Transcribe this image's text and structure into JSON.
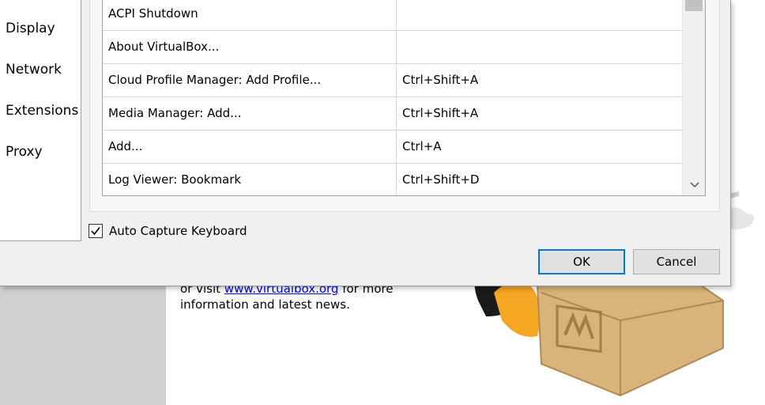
{
  "background": {
    "welcome_prefix": "or visit ",
    "welcome_link": "www.virtualbox.org",
    "welcome_suffix": " for more information and latest news."
  },
  "sidebar": {
    "items": [
      {
        "label": "Display"
      },
      {
        "label": "Network"
      },
      {
        "label": "Extensions"
      },
      {
        "label": "Proxy"
      }
    ]
  },
  "shortcuts_table": {
    "rows": [
      {
        "action": "ACPI Shutdown",
        "shortcut": ""
      },
      {
        "action": "About VirtualBox...",
        "shortcut": ""
      },
      {
        "action": "Cloud Profile Manager: Add Profile...",
        "shortcut": "Ctrl+Shift+A"
      },
      {
        "action": "Media Manager: Add...",
        "shortcut": "Ctrl+Shift+A"
      },
      {
        "action": "Add...",
        "shortcut": "Ctrl+A"
      },
      {
        "action": "Log Viewer: Bookmark",
        "shortcut": "Ctrl+Shift+D"
      }
    ]
  },
  "auto_capture": {
    "label": "Auto Capture Keyboard",
    "checked": true
  },
  "buttons": {
    "ok": "OK",
    "cancel": "Cancel"
  },
  "colors": {
    "accent": "#0078d7",
    "link": "#0000ee",
    "mascot_orange": "#f5a623",
    "box_wood": "#d8b47a"
  }
}
